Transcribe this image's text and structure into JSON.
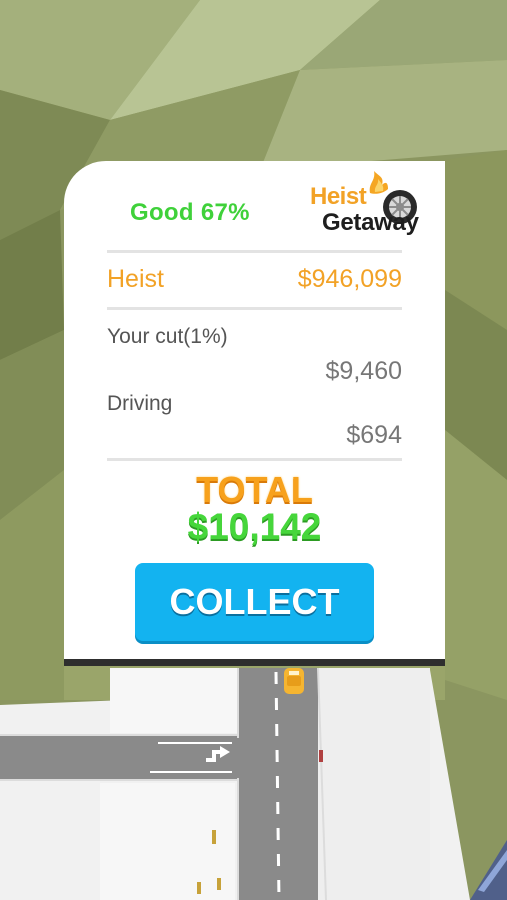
{
  "result": {
    "rating": "Good 67%",
    "logo": {
      "line1": "Heist",
      "line2": "Getaway"
    },
    "heist": {
      "label": "Heist",
      "value": "$946,099"
    },
    "cut": {
      "label": "Your cut(1%)",
      "value": "$9,460"
    },
    "driving": {
      "label": "Driving",
      "value": "$694"
    },
    "total": {
      "label": "TOTAL",
      "value": "$10,142"
    },
    "collect_label": "COLLECT"
  },
  "colors": {
    "rating_green": "#3fd13a",
    "heist_orange": "#f2a226",
    "total_orange": "#f7a11c",
    "total_green": "#46d63b",
    "button_blue": "#13b3f0"
  },
  "icons": [
    "flame-icon",
    "wheel-icon",
    "turn-arrow-icon",
    "taxi-car"
  ]
}
